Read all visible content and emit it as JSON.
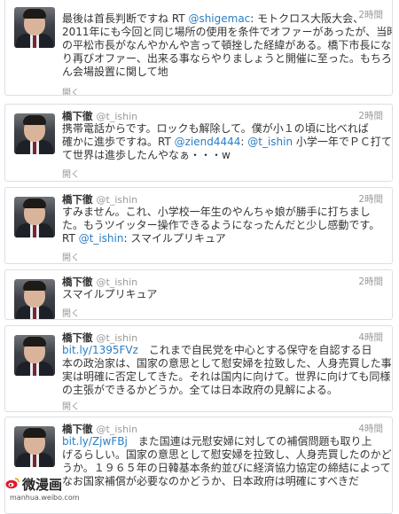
{
  "tweets": [
    {
      "name": "",
      "handle": "",
      "time": "2時間",
      "lines": [
        [
          {
            "t": "最後は首長判断ですね RT "
          },
          {
            "t": "@shigemac",
            "c": "mention"
          },
          {
            "t": ": モトクロス大阪大会、"
          }
        ],
        [
          {
            "t": "2011年にも今回と同じ場所の使用を条件でオファーがあったが、当時"
          }
        ],
        [
          {
            "t": "の平松市長がなんやかんや言って頓挫した経緯がある。橋下市長にな"
          }
        ],
        [
          {
            "t": "り再びオファー、出来る事ならやりましょうと開催に至った。もちろ"
          }
        ],
        [
          {
            "t": "ん会場設置に関して地"
          }
        ]
      ],
      "expand": "開く"
    },
    {
      "name": "橋下徹",
      "handle": "@t_ishin",
      "time": "2時間",
      "lines": [
        [
          {
            "t": "携帯電話からです。ロックも解除して。僕が小１の頃に比べれば"
          }
        ],
        [
          {
            "t": "確かに進歩ですね。RT "
          },
          {
            "t": "@ziend4444",
            "c": "mention"
          },
          {
            "t": ": "
          },
          {
            "t": "@t_ishin",
            "c": "mention"
          },
          {
            "t": " 小学一年でＰＣ打てるっ"
          }
        ],
        [
          {
            "t": "て世界は進歩したんやなぁ・・・w"
          }
        ]
      ],
      "expand": "開く"
    },
    {
      "name": "橋下徹",
      "handle": "@t_ishin",
      "time": "2時間",
      "lines": [
        [
          {
            "t": "すみません。これ、小学校一年生のやんちゃ娘が勝手に打ちまし"
          }
        ],
        [
          {
            "t": "た。もうツイッター操作できるようになったんだと少し感動です。"
          }
        ],
        [
          {
            "t": "RT "
          },
          {
            "t": "@t_ishin",
            "c": "mention"
          },
          {
            "t": ": スマイルプリキュア"
          }
        ]
      ],
      "expand": "開く"
    },
    {
      "name": "橋下徹",
      "handle": "@t_ishin",
      "time": "2時間",
      "lines": [
        [
          {
            "t": "スマイルプリキュア"
          }
        ]
      ],
      "expand": "開く"
    },
    {
      "name": "橋下徹",
      "handle": "@t_ishin",
      "time": "4時間",
      "lines": [
        [
          {
            "t": "bit.ly/1395FVz",
            "c": "link"
          },
          {
            "t": "　これまで自民党を中心とする保守を自認する日"
          }
        ],
        [
          {
            "t": "本の政治家は、国家の意思として慰安婦を拉致した、人身売買した事"
          }
        ],
        [
          {
            "t": "実は明確に否定してきた。それは国内に向けて。世界に向けても同様"
          }
        ],
        [
          {
            "t": "の主張ができるかどうか。全ては日本政府の見解による。"
          }
        ]
      ],
      "expand": "開く"
    },
    {
      "name": "橋下徹",
      "handle": "@t_ishin",
      "time": "4時間",
      "lines": [
        [
          {
            "t": "bit.ly/ZjwFBj",
            "c": "link"
          },
          {
            "t": "　また国連は元慰安婦に対しての補償問題も取り上"
          }
        ],
        [
          {
            "t": "げるらしい。国家の意思として慰安婦を拉致し、人身売買したのかど"
          }
        ],
        [
          {
            "t": "うか。１９６５年の日韓基本条約並びに経済協力協定の締結によって"
          }
        ],
        [
          {
            "t": "なお国家補償が必要なのかどうか、日本政府は明確にすべきだ"
          }
        ]
      ],
      "expand": ""
    }
  ],
  "watermark": {
    "title": "微漫画",
    "url": "manhua.weibo.com"
  }
}
